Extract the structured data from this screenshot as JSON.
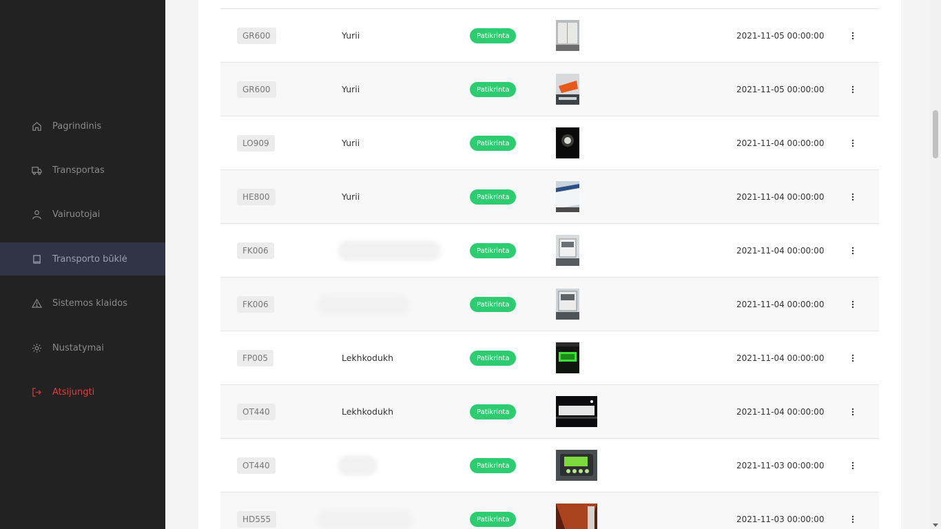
{
  "sidebar": {
    "items": [
      {
        "label": "Pagrindinis",
        "icon": "home-icon"
      },
      {
        "label": "Transportas",
        "icon": "truck-icon"
      },
      {
        "label": "Vairuotojai",
        "icon": "user-icon"
      },
      {
        "label": "Transporto būklė",
        "icon": "book-icon"
      },
      {
        "label": "Sistemos klaidos",
        "icon": "warning-icon"
      },
      {
        "label": "Nustatymai",
        "icon": "gear-icon"
      },
      {
        "label": "Atsijungti",
        "icon": "logout-icon"
      }
    ],
    "active_index": 3
  },
  "colors": {
    "sidebar_bg": "#222222",
    "active_bg": "#2f3544",
    "status_green": "#2ecc71",
    "logout_red": "#e23b3b"
  },
  "table": {
    "rows": [
      {
        "plate": "GR600",
        "driver": "Yurii",
        "status": "Patikrinta",
        "photo": "trailer-rear-photo",
        "date": "2021-11-05 00:00:00"
      },
      {
        "plate": "GR600",
        "driver": "Yurii",
        "status": "Patikrinta",
        "photo": "orange-tag-photo",
        "date": "2021-11-05 00:00:00"
      },
      {
        "plate": "LO909",
        "driver": "Yurii",
        "status": "Patikrinta",
        "photo": "light-dark-photo",
        "date": "2021-11-04 00:00:00"
      },
      {
        "plate": "HE800",
        "driver": "Yurii",
        "status": "Patikrinta",
        "photo": "trailer-side-photo",
        "date": "2021-11-04 00:00:00"
      },
      {
        "plate": "FK006",
        "driver": "",
        "status": "Patikrinta",
        "photo": "reefer-unit-photo",
        "date": "2021-11-04 00:00:00"
      },
      {
        "plate": "FK006",
        "driver": "",
        "status": "Patikrinta",
        "photo": "reefer-unit-photo",
        "date": "2021-11-04 00:00:00"
      },
      {
        "plate": "FP005",
        "driver": "Lekhkodukh",
        "status": "Patikrinta",
        "photo": "green-display-photo",
        "date": "2021-11-04 00:00:00"
      },
      {
        "plate": "OT440",
        "driver": "Lekhkodukh",
        "status": "Patikrinta",
        "photo": "night-trailer-photo",
        "date": "2021-11-04 00:00:00"
      },
      {
        "plate": "OT440",
        "driver": "",
        "status": "Patikrinta",
        "photo": "control-panel-photo",
        "date": "2021-11-03 00:00:00"
      },
      {
        "plate": "HD555",
        "driver": "",
        "status": "Patikrinta",
        "photo": "trailer-interior-photo",
        "date": "2021-11-03 00:00:00"
      }
    ]
  }
}
